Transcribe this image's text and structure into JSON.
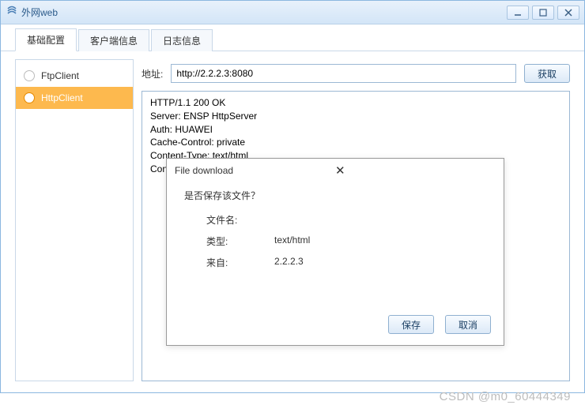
{
  "window": {
    "title": "外网web"
  },
  "tabs": {
    "basic": "基础配置",
    "client": "客户端信息",
    "log": "日志信息"
  },
  "sidebar": {
    "ftp": "FtpClient",
    "http": "HttpClient"
  },
  "address": {
    "label": "地址:",
    "value": "http://2.2.2.3:8080",
    "get": "获取"
  },
  "response": {
    "text": "HTTP/1.1 200 OK\nServer: ENSP HttpServer\nAuth: HUAWEI\nCache-Control: private\nContent-Type: text/html\nContent-Length: 179"
  },
  "dialog": {
    "title": "File download",
    "question": "是否保存该文件？",
    "filename_label": "文件名:",
    "filename_value": "",
    "type_label": "类型:",
    "type_value": "text/html",
    "from_label": "来自:",
    "from_value": "2.2.2.3",
    "save": "保存",
    "cancel": "取消"
  },
  "watermark": "CSDN @m0_60444349"
}
